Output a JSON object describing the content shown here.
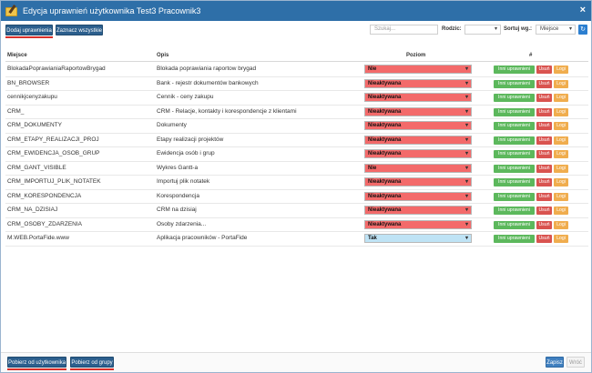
{
  "window": {
    "title": "Edycja uprawnień użytkownika Test3 Pracownik3",
    "close": "×"
  },
  "toolbar": {
    "add_label": "Dodaj uprawnienia",
    "select_all_label": "Zaznacz wszystkie",
    "search_placeholder": "Szukaj...",
    "parent_label": "Rodzic:",
    "parent_value": "",
    "sort_label": "Sortuj wg.:",
    "sort_value": "Miejsce",
    "refresh_icon": "↻"
  },
  "table": {
    "headers": {
      "place": "Miejsce",
      "desc": "Opis",
      "level": "Poziom",
      "actions": "#"
    },
    "action_labels": {
      "other": "Inni uprawnieni",
      "delete": "Usuń",
      "logs": "Logi"
    },
    "rows": [
      {
        "place": "BlokadaPoprawianiaRaportowBrygad",
        "desc": "Blokada poprawiania raportow brygad",
        "level": "Nie"
      },
      {
        "place": "BN_BROWSER",
        "desc": "Bank - rejestr dokumentów bankowych",
        "level": "Nieaktywana"
      },
      {
        "place": "cennikjcenyzakupu",
        "desc": "Cennik - ceny zakupu",
        "level": "Nieaktywana"
      },
      {
        "place": "CRM_",
        "desc": "CRM - Relacje, kontakty i korespondencje z klientami",
        "level": "Nieaktywana"
      },
      {
        "place": "CRM_DOKUMENTY",
        "desc": "Dokumenty",
        "level": "Nieaktywana"
      },
      {
        "place": "CRM_ETAPY_REALIZACJI_PROJ",
        "desc": "Etapy realizacji projektów",
        "level": "Nieaktywana"
      },
      {
        "place": "CRM_EWIDENCJA_OSOB_GRUP",
        "desc": "Ewidencja osób i grup",
        "level": "Nieaktywana"
      },
      {
        "place": "CRM_GANT_VISIBLE",
        "desc": "Wykres Gantt-a",
        "level": "Nie"
      },
      {
        "place": "CRM_IMPORTUJ_PLIK_NOTATEK",
        "desc": "Importuj plik notatek",
        "level": "Nieaktywana"
      },
      {
        "place": "CRM_KORESPONDENCJA",
        "desc": "Korespondencja",
        "level": "Nieaktywana"
      },
      {
        "place": "CRM_NA_DZISIAJ",
        "desc": "CRM na dzisiaj",
        "level": "Nieaktywana"
      },
      {
        "place": "CRM_OSOBY_ZDARZENIA",
        "desc": "Osoby zdarzenia...",
        "level": "Nieaktywana"
      },
      {
        "place": "M.WEB.PortaFide.www",
        "desc": "Aplikacja pracowników - PortaFide",
        "level": "Tak"
      }
    ]
  },
  "footer": {
    "from_user_label": "Pobierz od użytkownika",
    "from_group_label": "Pobierz od grupy",
    "save_label": "Zapisz",
    "back_label": "Wróć"
  },
  "colors": {
    "level_no": "#f36a6a",
    "level_inactive": "#f36a6a",
    "level_yes": "#bfe3f5"
  }
}
